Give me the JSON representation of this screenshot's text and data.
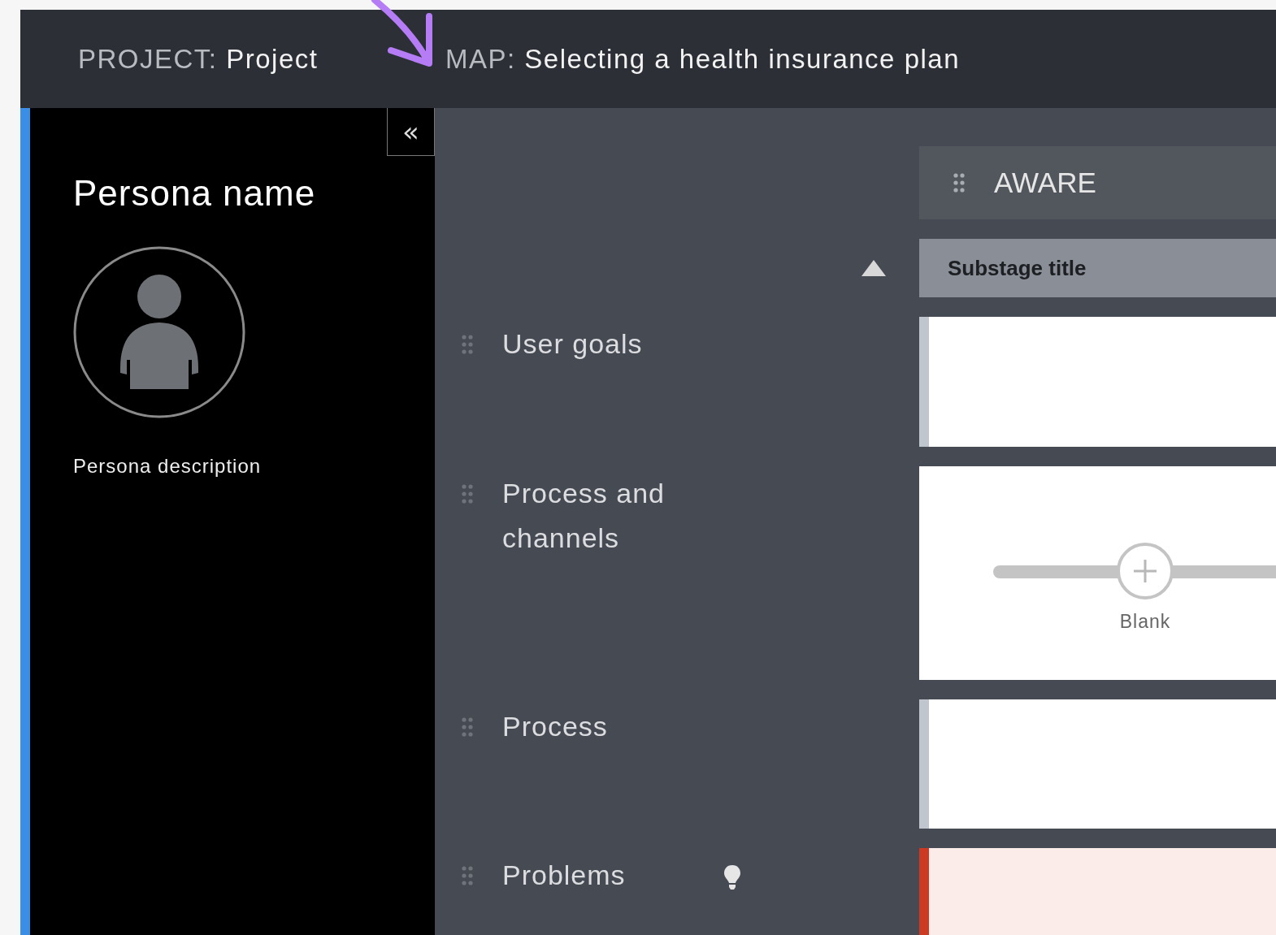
{
  "header": {
    "project_label": "PROJECT:",
    "project_name": "Project",
    "map_label": "MAP:",
    "map_name": "Selecting a health insurance plan"
  },
  "annotation": {
    "kind": "arrow"
  },
  "sidebar": {
    "collapse_icon": "«",
    "persona_name": "Persona name",
    "persona_description": "Persona description"
  },
  "stage": {
    "title": "AWARE"
  },
  "substage": {
    "title": "Substage title",
    "expanded": true
  },
  "lanes": [
    {
      "label": "User goals",
      "kind": "text"
    },
    {
      "label": "Process and channels",
      "kind": "curve",
      "point_label": "Blank"
    },
    {
      "label": "Process",
      "kind": "text"
    },
    {
      "label": "Problems",
      "kind": "problem"
    }
  ]
}
